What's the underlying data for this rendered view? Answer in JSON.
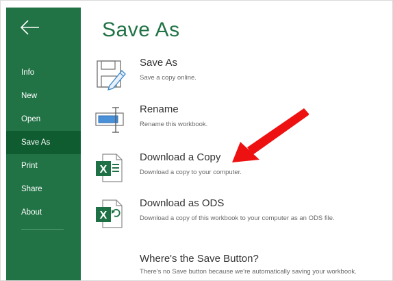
{
  "page": {
    "title": "Save As"
  },
  "sidebar": {
    "back_icon": "back-arrow-icon",
    "items": [
      {
        "label": "Info",
        "active": false
      },
      {
        "label": "New",
        "active": false
      },
      {
        "label": "Open",
        "active": false
      },
      {
        "label": "Save As",
        "active": true
      },
      {
        "label": "Print",
        "active": false
      },
      {
        "label": "Share",
        "active": false
      },
      {
        "label": "About",
        "active": false
      }
    ]
  },
  "options": [
    {
      "icon": "save-as-disk-pencil-icon",
      "label": "Save As",
      "desc": "Save a copy online."
    },
    {
      "icon": "rename-icon",
      "label": "Rename",
      "desc": "Rename this workbook."
    },
    {
      "icon": "excel-download-icon",
      "label": "Download a Copy",
      "desc": "Download a copy to your computer."
    },
    {
      "icon": "excel-ods-icon",
      "label": "Download as ODS",
      "desc": "Download a copy of this workbook to your computer as an ODS file."
    }
  ],
  "help": {
    "label": "Where's the Save Button?",
    "desc": "There's no Save button because we're automatically saving your workbook."
  },
  "annotation": {
    "icon": "red-arrow-icon",
    "color": "#ee1111"
  },
  "colors": {
    "brand_green": "#217346",
    "sidebar_active": "#0e5c30",
    "excel_green": "#1e7145"
  }
}
